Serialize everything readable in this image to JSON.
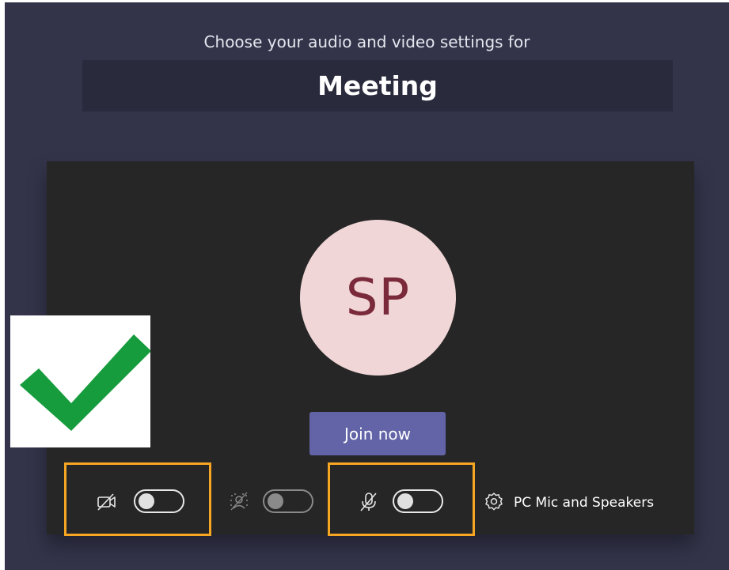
{
  "header": {
    "subtitle": "Choose your audio and video settings for",
    "meeting_title": "Meeting"
  },
  "preview": {
    "avatar_initials": "SP",
    "join_label": "Join now"
  },
  "controls": {
    "camera": {
      "icon": "camera-off-icon",
      "enabled": false
    },
    "background_blur": {
      "icon": "background-blur-icon",
      "enabled": false,
      "disabled": true
    },
    "microphone": {
      "icon": "mic-off-icon",
      "enabled": false
    },
    "device": {
      "icon": "gear-icon",
      "label": "PC Mic and Speakers"
    }
  },
  "annotations": {
    "checkmark_icon": "checkmark-icon",
    "highlight_color": "#f6a623",
    "check_color": "#169c3c"
  },
  "colors": {
    "app_bg": "#33344a",
    "title_bg": "#292a3c",
    "preview_bg": "#262626",
    "avatar_bg": "#f1d6d7",
    "avatar_text": "#7a2a3a",
    "join_button": "#6264a7"
  }
}
